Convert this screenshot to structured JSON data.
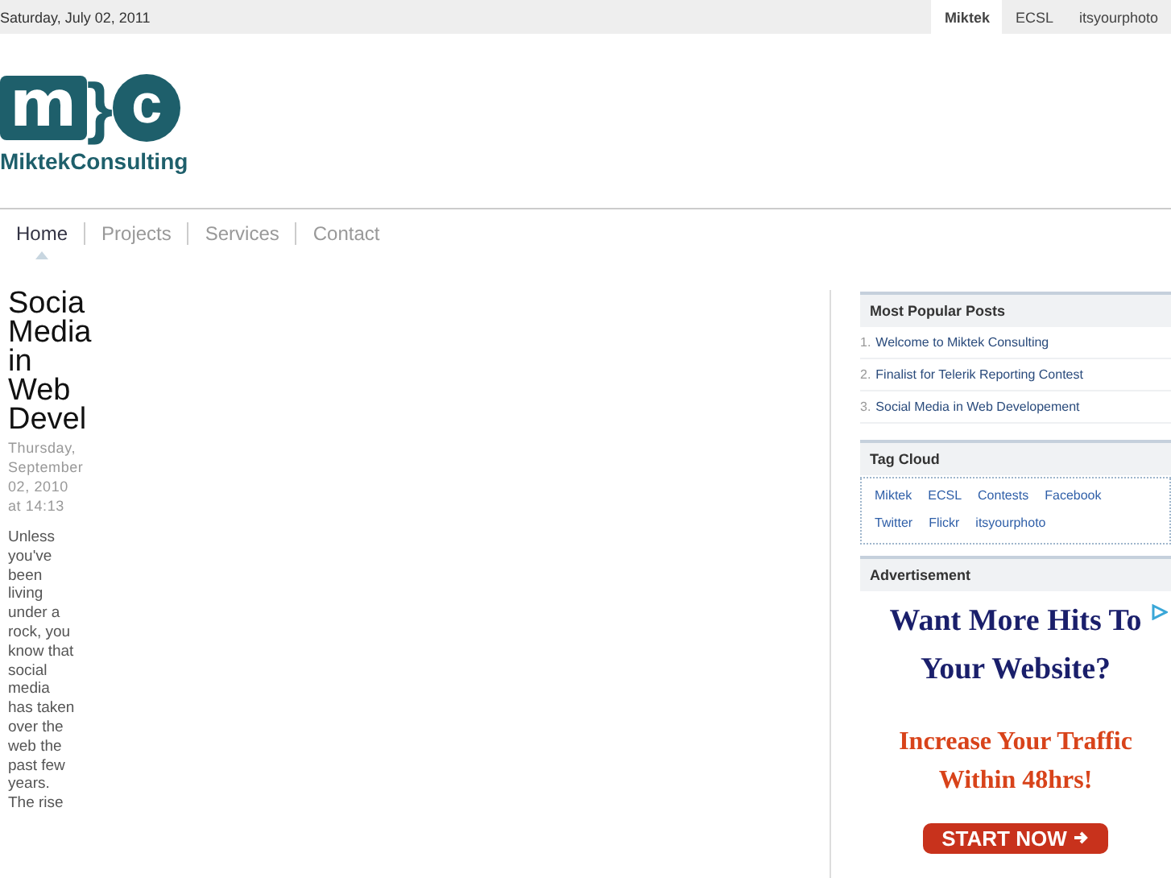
{
  "top_bar": {
    "date": "Saturday, July 02, 2011",
    "sites": [
      {
        "label": "Miktek",
        "selected": true
      },
      {
        "label": "ECSL",
        "selected": false
      },
      {
        "label": "itsyourphoto",
        "selected": false
      }
    ]
  },
  "logo": {
    "mark": "m}c",
    "name": "MiktekConsulting"
  },
  "nav": [
    {
      "label": "Home",
      "selected": true
    },
    {
      "label": "Projects",
      "selected": false
    },
    {
      "label": "Services",
      "selected": false
    },
    {
      "label": "Contact",
      "selected": false
    }
  ],
  "post": {
    "title": "Socia Media in Web Devel",
    "date": "Thursday, September 02, 2010 at 14:13",
    "body": "Unless you've been living under a rock, you know that social media has taken over the web the past few years. The rise"
  },
  "sidebar": {
    "popular": {
      "title": "Most Popular Posts",
      "items": [
        {
          "number": "1.",
          "label": "Welcome to Miktek Consulting"
        },
        {
          "number": "2.",
          "label": "Finalist for Telerik Reporting Contest"
        },
        {
          "number": "3.",
          "label": "Social Media in Web Developement"
        }
      ]
    },
    "tags": {
      "title": "Tag Cloud",
      "items": [
        "Miktek",
        "ECSL",
        "Contests",
        "Facebook",
        "Twitter",
        "Flickr",
        "itsyourphoto"
      ]
    },
    "ad": {
      "title": "Advertisement",
      "headline": "Want More Hits To Your Website?",
      "subline": "Increase Your Traffic Within 48hrs!",
      "button": "START NOW"
    }
  }
}
